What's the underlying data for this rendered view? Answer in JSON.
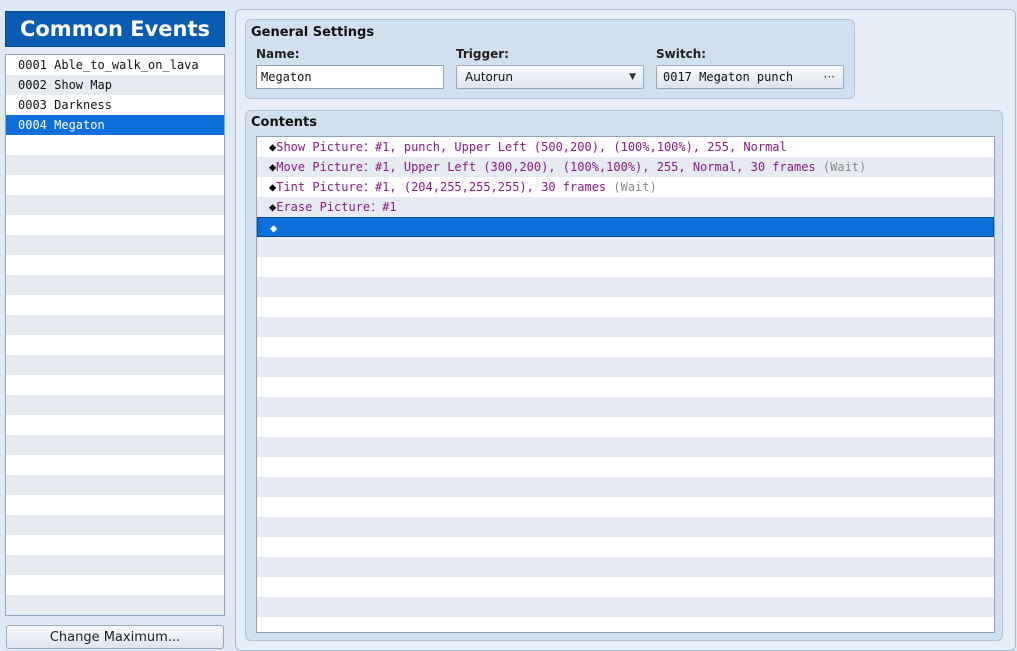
{
  "left": {
    "title": "Common Events",
    "events": [
      {
        "label": "0001 Able_to_walk_on_lava",
        "selected": false
      },
      {
        "label": "0002 Show Map",
        "selected": false
      },
      {
        "label": "0003 Darkness",
        "selected": false
      },
      {
        "label": "0004 Megaton",
        "selected": true
      }
    ],
    "total_rows": 28,
    "change_max_label": "Change Maximum..."
  },
  "general": {
    "title": "General Settings",
    "name_label": "Name:",
    "name_value": "Megaton",
    "trigger_label": "Trigger:",
    "trigger_value": "Autorun",
    "switch_label": "Switch:",
    "switch_value": "0017 Megaton punch",
    "switch_button": "···"
  },
  "contents": {
    "title": "Contents",
    "commands": [
      {
        "marker": "◆",
        "name": "Show Picture",
        "sep": "：",
        "args": "#1, punch, Upper Left (500,200), (100%,100%), 255, Normal",
        "wait": ""
      },
      {
        "marker": "◆",
        "name": "Move Picture",
        "sep": "：",
        "args": "#1, Upper Left (300,200), (100%,100%), 255, Normal, 30 frames",
        "wait": "(Wait)"
      },
      {
        "marker": "◆",
        "name": "Tint Picture",
        "sep": "：",
        "args": "#1, (204,255,255,255), 30 frames",
        "wait": "(Wait)"
      },
      {
        "marker": "◆",
        "name": "Erase Picture",
        "sep": "：",
        "args": "#1",
        "wait": ""
      },
      {
        "marker": "◆",
        "name": "",
        "sep": "",
        "args": "",
        "wait": "",
        "selected": true
      }
    ],
    "total_rows": 25
  },
  "colors": {
    "accent": "#0d6fd9",
    "command_text": "#8b1a8b",
    "wait_text": "#8a8a8a"
  }
}
